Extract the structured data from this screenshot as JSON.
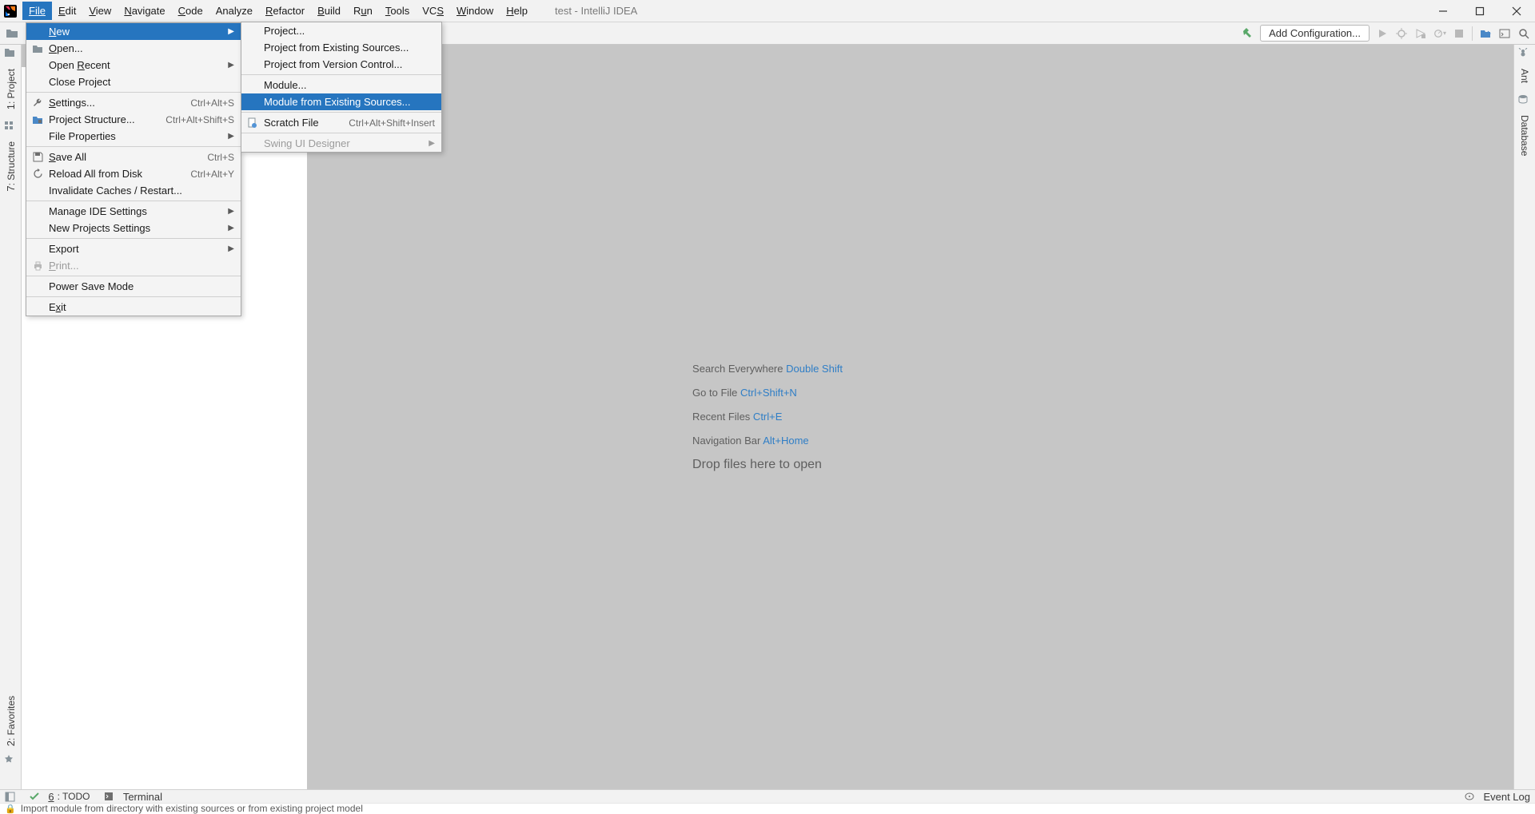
{
  "window": {
    "title": "test - IntelliJ IDEA"
  },
  "menubar": {
    "file": "File",
    "edit": "Edit",
    "view": "View",
    "navigate": "Navigate",
    "code": "Code",
    "analyze": "Analyze",
    "refactor": "Refactor",
    "build": "Build",
    "run": "Run",
    "tools": "Tools",
    "vcs": "VCS",
    "window": "Window",
    "help": "Help"
  },
  "toolbar": {
    "add_config": "Add Configuration..."
  },
  "left_tabs": {
    "project": "1: Project",
    "structure": "7: Structure",
    "favorites": "2: Favorites"
  },
  "right_tabs": {
    "ant": "Ant",
    "database": "Database"
  },
  "bottom_tabs": {
    "todo": "6: TODO",
    "terminal": "Terminal",
    "event_log": "Event Log"
  },
  "status": {
    "text": "Import module from directory with existing sources or from existing project model"
  },
  "hints": {
    "search_label": "Search Everywhere ",
    "search_kbd": "Double Shift",
    "goto_label": "Go to File ",
    "goto_kbd": "Ctrl+Shift+N",
    "recent_label": "Recent Files ",
    "recent_kbd": "Ctrl+E",
    "nav_label": "Navigation Bar ",
    "nav_kbd": "Alt+Home",
    "drop": "Drop files here to open"
  },
  "file_menu": {
    "new": "New",
    "open": "Open...",
    "open_recent": "Open Recent",
    "close_project": "Close Project",
    "settings": "Settings...",
    "settings_sc": "Ctrl+Alt+S",
    "project_structure": "Project Structure...",
    "project_structure_sc": "Ctrl+Alt+Shift+S",
    "file_properties": "File Properties",
    "save_all": "Save All",
    "save_all_sc": "Ctrl+S",
    "reload": "Reload All from Disk",
    "reload_sc": "Ctrl+Alt+Y",
    "invalidate": "Invalidate Caches / Restart...",
    "manage_ide": "Manage IDE Settings",
    "new_projects_settings": "New Projects Settings",
    "export": "Export",
    "print": "Print...",
    "power_save": "Power Save Mode",
    "exit": "Exit"
  },
  "new_submenu": {
    "project": "Project...",
    "project_existing": "Project from Existing Sources...",
    "project_vcs": "Project from Version Control...",
    "module": "Module...",
    "module_existing": "Module from Existing Sources...",
    "scratch": "Scratch File",
    "scratch_sc": "Ctrl+Alt+Shift+Insert",
    "swing": "Swing UI Designer"
  }
}
